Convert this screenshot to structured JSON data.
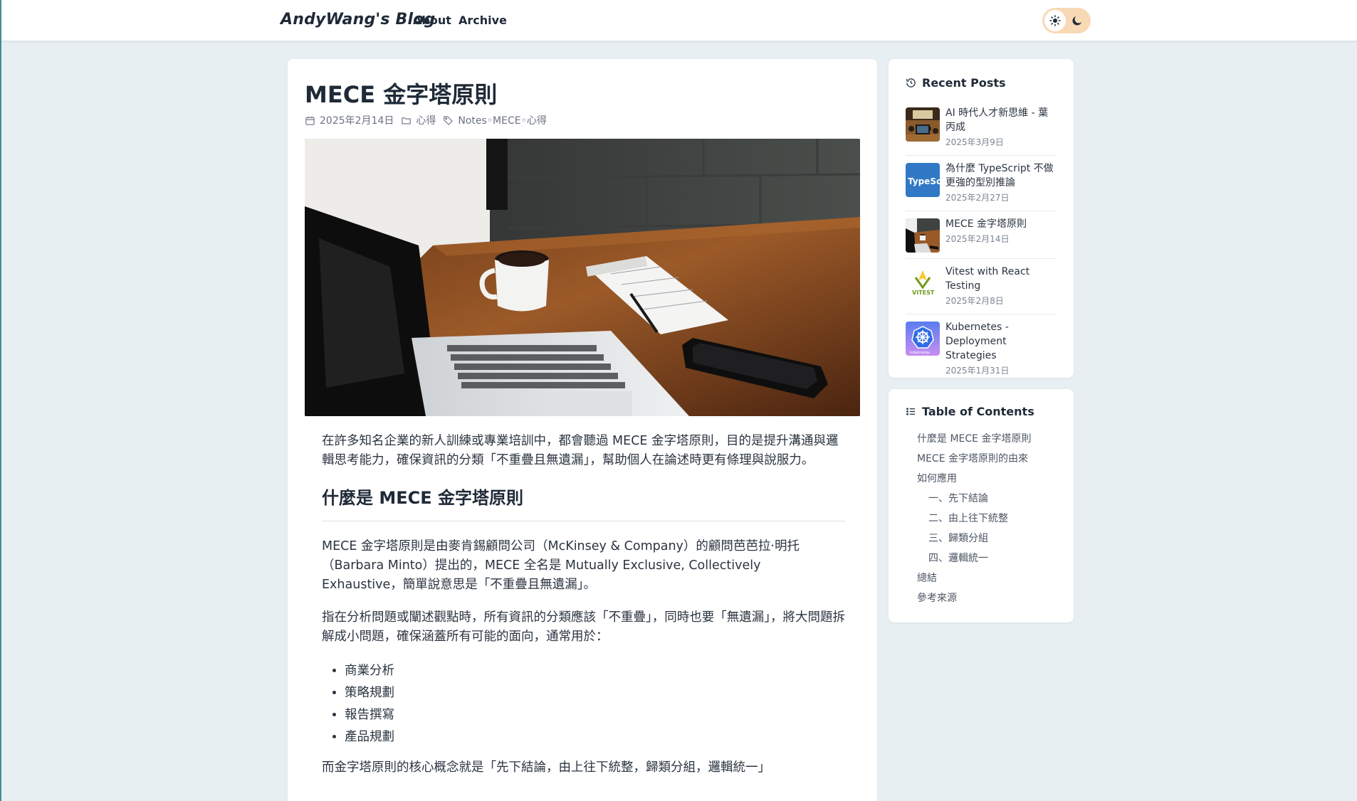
{
  "header": {
    "brand": "AndyWang's Blog",
    "nav": [
      "About",
      "Archive"
    ],
    "theme_toggle": {
      "light_icon": "sun-icon",
      "dark_icon": "moon-icon",
      "accent": "#f8d9b5"
    }
  },
  "post": {
    "title": "MECE 金字塔原則",
    "date": "2025年2月14日",
    "category": "心得",
    "tags": "Notes◦MECE◦心得",
    "hero_image": "laptop-coffee-desk-image",
    "intro": "在許多知名企業的新人訓練或專業培訓中，都會聽過 MECE 金字塔原則，目的是提升溝通與邏輯思考能力，確保資訊的分類「不重疊且無遺漏」，幫助個人在論述時更有條理與說服力。",
    "h2_1": "什麼是 MECE 金字塔原則",
    "p1": "MECE 金字塔原則是由麥肯錫顧問公司（McKinsey & Company）的顧問芭芭拉·明托（Barbara Minto）提出的，MECE 全名是 Mutually Exclusive, Collectively Exhaustive，簡單說意思是「不重疊且無遺漏」。",
    "p2": "指在分析問題或闡述觀點時，所有資訊的分類應該「不重疊」，同時也要「無遺漏」，將大問題拆解成小問題，確保涵蓋所有可能的面向，通常用於：",
    "bullets": [
      "商業分析",
      "策略規劃",
      "報告撰寫",
      "產品規劃"
    ],
    "p3": "而金字塔原則的核心概念就是「先下結論，由上往下統整，歸類分組，邏輯統一」"
  },
  "sidebar": {
    "recent_title": "Recent Posts",
    "recent_posts": [
      {
        "title": "AI 時代人才新思維 - 葉丙成",
        "date": "2025年3月9日",
        "thumb": "conference-thumb"
      },
      {
        "title": "為什麼 TypeScript 不做更強的型別推論",
        "date": "2025年2月27日",
        "thumb": "typescript-thumb"
      },
      {
        "title": "MECE 金字塔原則",
        "date": "2025年2月14日",
        "thumb": "desk-thumb"
      },
      {
        "title": "Vitest with React Testing",
        "date": "2025年2月8日",
        "thumb": "vitest-thumb"
      },
      {
        "title": "Kubernetes - Deployment Strategies",
        "date": "2025年1月31日",
        "thumb": "kubernetes-thumb"
      }
    ],
    "thumb_text": {
      "typescript": "TypeSc",
      "vitest": "VITEST",
      "kubernetes": "kubernetes"
    },
    "toc_title": "Table of Contents",
    "toc": [
      {
        "label": "什麼是 MECE 金字塔原則",
        "sub": false
      },
      {
        "label": "MECE 金字塔原則的由來",
        "sub": false
      },
      {
        "label": "如何應用",
        "sub": false
      },
      {
        "label": "一、先下結論",
        "sub": true
      },
      {
        "label": "二、由上往下統整",
        "sub": true
      },
      {
        "label": "三、歸類分組",
        "sub": true
      },
      {
        "label": "四、邏輯統一",
        "sub": true
      },
      {
        "label": "總結",
        "sub": false
      },
      {
        "label": "參考來源",
        "sub": false
      }
    ]
  }
}
